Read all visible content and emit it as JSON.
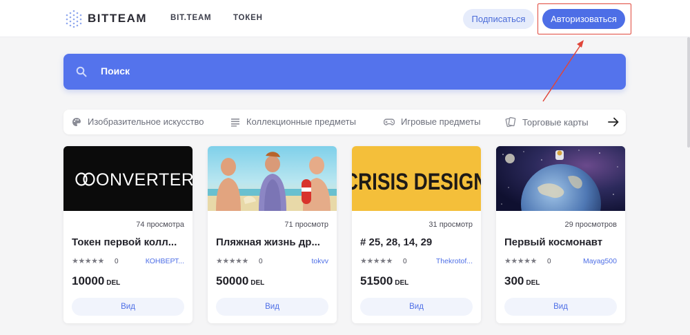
{
  "header": {
    "logo_text": "BITTEAM",
    "nav": [
      {
        "label": "BIT.TEAM"
      },
      {
        "label": "ТОКЕН"
      }
    ],
    "subscribe_label": "Подписаться",
    "login_label": "Авторизоваться"
  },
  "search": {
    "placeholder": "Поиск"
  },
  "categories": [
    {
      "label": "Изобразительное искусство",
      "icon": "palette-icon"
    },
    {
      "label": "Коллекционные предметы",
      "icon": "list-icon"
    },
    {
      "label": "Игровые предметы",
      "icon": "gamepad-icon"
    },
    {
      "label": "Торговые карты",
      "icon": "cards-icon"
    }
  ],
  "cards": [
    {
      "image_text": "ONVERTER",
      "views": "74 просмотра",
      "title": "Токен первой колл...",
      "rating": "0",
      "author": "КОНВЕРТ...",
      "price": "10000",
      "currency": "DEL",
      "view_label": "Вид"
    },
    {
      "views": "71 просмотр",
      "title": "Пляжная жизнь др...",
      "rating": "0",
      "author": "tokvv",
      "price": "50000",
      "currency": "DEL",
      "view_label": "Вид"
    },
    {
      "image_text": "CRISIS DESIGN",
      "views": "31 просмотр",
      "title": "# 25, 28, 14, 29",
      "rating": "0",
      "author": "Thekrotof...",
      "price": "51500",
      "currency": "DEL",
      "view_label": "Вид"
    },
    {
      "views": "29 просмотров",
      "title": "Первый космонавт",
      "rating": "0",
      "author": "Mayag500",
      "price": "300",
      "currency": "DEL",
      "view_label": "Вид"
    }
  ],
  "colors": {
    "accent": "#4d6ee6",
    "search_bg": "#5473ec",
    "highlight": "#e0463a",
    "card_3_bg": "#f4bf3a"
  }
}
